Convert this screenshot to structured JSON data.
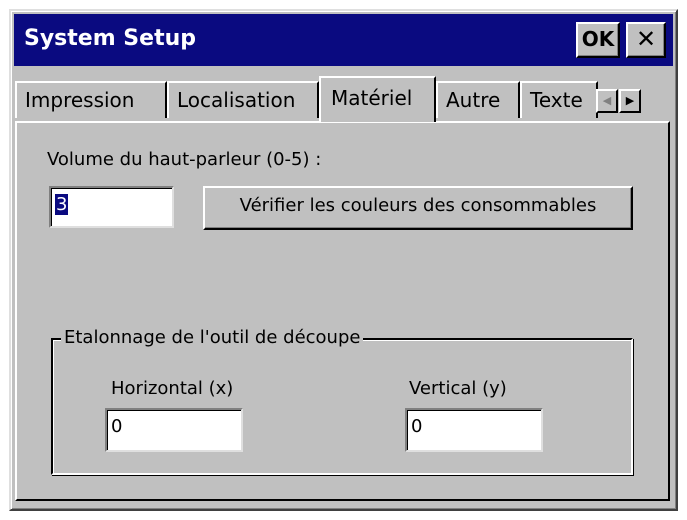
{
  "window": {
    "title": "System Setup",
    "ok_label": "OK",
    "close_label": "✕"
  },
  "tabs": [
    {
      "label": "Impression",
      "active": false
    },
    {
      "label": "Localisation",
      "active": false
    },
    {
      "label": "Matériel",
      "active": true
    },
    {
      "label": "Autre",
      "active": false
    },
    {
      "label": "Texte",
      "active": false
    }
  ],
  "tab_scroll": {
    "left_icon": "◀",
    "right_icon": "▶"
  },
  "hardware": {
    "volume_label": "Volume du haut-parleur (0-5) :",
    "volume_value": "3",
    "check_colors_button": "Vérifier les couleurs des consommables"
  },
  "calibration": {
    "group_title": "Etalonnage de l'outil de découpe",
    "horizontal_label": "Horizontal (x)",
    "horizontal_value": "0",
    "vertical_label": "Vertical (y)",
    "vertical_value": "0"
  },
  "colors": {
    "titlebar": "#0a0a80",
    "face": "#c0c0c0",
    "selection": "#0a0a80"
  }
}
